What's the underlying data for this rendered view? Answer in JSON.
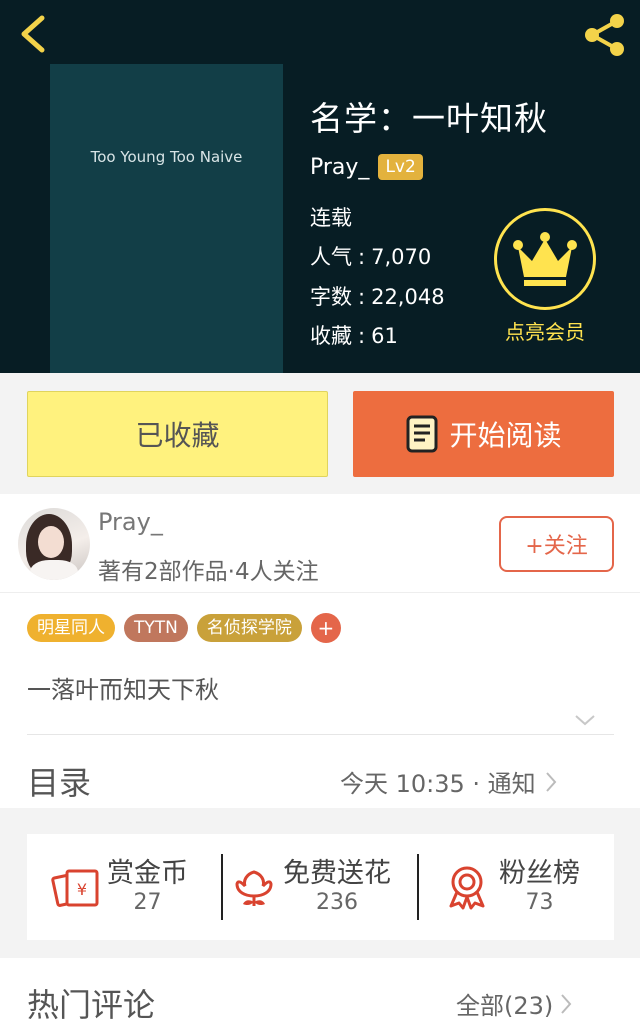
{
  "header": {
    "cover_text": "Too Young Too Naive",
    "title": "名学：一叶知秋",
    "author": "Pray_",
    "level_badge": "Lv2",
    "status": "连载",
    "stats": [
      {
        "label": "人气",
        "value": "7,070"
      },
      {
        "label": "字数",
        "value": "22,048"
      },
      {
        "label": "收藏",
        "value": "61"
      }
    ],
    "vip_label": "点亮会员",
    "icons": {
      "back": "back-chevron-icon",
      "share": "share-icon",
      "vip": "crown-icon"
    }
  },
  "actions": {
    "collected_label": "已收藏",
    "read_label": "开始阅读"
  },
  "author_card": {
    "name": "Pray_",
    "subtitle": "著有2部作品·4人关注",
    "follow_label": "+关注"
  },
  "tags": [
    {
      "label": "明星同人",
      "color": "#efb12f"
    },
    {
      "label": "TYTN",
      "color": "#c0775d"
    },
    {
      "label": "名侦探学院",
      "color": "#c9a13a"
    }
  ],
  "tag_add_label": "+",
  "summary": "一落叶而知天下秋",
  "toc": {
    "title": "目录",
    "update_text": "今天 10:35 · 通知"
  },
  "stat_bar": [
    {
      "label": "赏金币",
      "value": "27",
      "icon": "red-envelope-icon"
    },
    {
      "label": "免费送花",
      "value": "236",
      "icon": "flower-icon"
    },
    {
      "label": "粉丝榜",
      "value": "73",
      "icon": "medal-icon"
    }
  ],
  "comments": {
    "title": "热门评论",
    "all_label": "全部(23)"
  },
  "colors": {
    "header_bg": "#071d24",
    "accent_orange": "#ed6d3f",
    "accent_yellow": "#fff27e",
    "vip_yellow": "#ffe34f",
    "icon_red": "#d9432f"
  }
}
